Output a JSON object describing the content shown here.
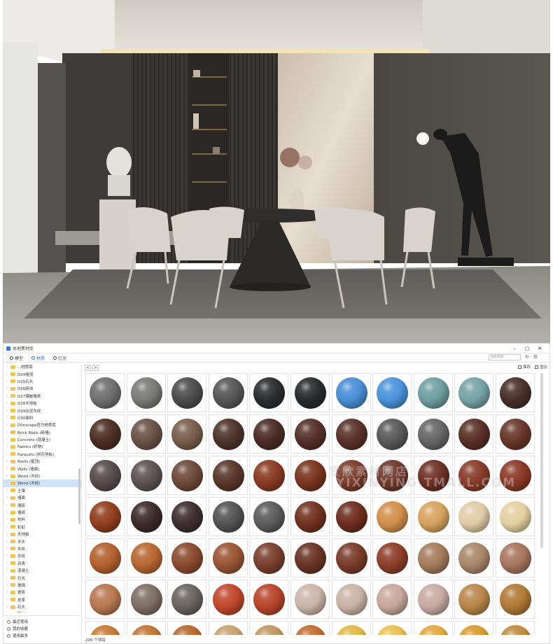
{
  "window": {
    "title": "本地素材库",
    "minimize": "–",
    "maximize": "▢",
    "close": "✕"
  },
  "tabs": [
    {
      "label": "模型",
      "active": false
    },
    {
      "label": "材质",
      "active": true
    },
    {
      "label": "灯光",
      "active": false
    }
  ],
  "sidebar": {
    "items": [
      {
        "label": "...材质库",
        "expanded": false,
        "selected": false
      },
      {
        "label": "D24墙顶",
        "selected": false
      },
      {
        "label": "D25石头",
        "selected": false
      },
      {
        "label": "D26砖块",
        "selected": false
      },
      {
        "label": "D27镶嵌墙纸",
        "selected": false
      },
      {
        "label": "D28木地板",
        "selected": false
      },
      {
        "label": "D29水泥木纹",
        "selected": false
      },
      {
        "label": "D30面料",
        "selected": false
      },
      {
        "label": "D0nscape官方材质库",
        "selected": false
      },
      {
        "label": "Brick Walls (砖墙)",
        "selected": false
      },
      {
        "label": "Concrete (混凝土)",
        "selected": false
      },
      {
        "label": "Fabrics (织物)",
        "selected": false
      },
      {
        "label": "Parquets (拼花地板)",
        "selected": false
      },
      {
        "label": "Roofs (屋顶)",
        "selected": false
      },
      {
        "label": "Walls (墙面)",
        "selected": false
      },
      {
        "label": "Wood (木纹)",
        "selected": false
      },
      {
        "label": "Wood (木纹)",
        "selected": true
      },
      {
        "label": "土壤",
        "selected": false
      },
      {
        "label": "墙面",
        "selected": false
      },
      {
        "label": "墙砖",
        "selected": false
      },
      {
        "label": "墙纸",
        "selected": false
      },
      {
        "label": "布料",
        "selected": false
      },
      {
        "label": "彩虹",
        "selected": false
      },
      {
        "label": "木地板",
        "selected": false
      },
      {
        "label": "木头",
        "selected": false
      },
      {
        "label": "木纹",
        "selected": false
      },
      {
        "label": "水纹",
        "selected": false
      },
      {
        "label": "沥青",
        "selected": false
      },
      {
        "label": "混凝土",
        "selected": false
      },
      {
        "label": "灯光",
        "selected": false
      },
      {
        "label": "玻璃",
        "selected": false
      },
      {
        "label": "瓷砖",
        "selected": false
      },
      {
        "label": "皮革",
        "selected": false
      },
      {
        "label": "石头",
        "selected": false
      },
      {
        "label": "草地",
        "selected": false
      },
      {
        "label": "织物",
        "selected": false
      },
      {
        "label": "塑料",
        "selected": false
      },
      {
        "label": "车漆",
        "selected": false
      },
      {
        "label": "车灯",
        "selected": false
      }
    ],
    "bottom": [
      {
        "label": "最近使用",
        "icon": "clock-icon"
      },
      {
        "label": "我的收藏",
        "icon": "star-icon"
      },
      {
        "label": "使用最多",
        "icon": "chart-icon"
      }
    ]
  },
  "toolbar": {
    "back": "<",
    "forward": ">",
    "search_placeholder": "搜索材质...",
    "refresh": "↻",
    "menu": "☰",
    "save_label": "保存",
    "display_label": "显示"
  },
  "status": {
    "count_text": "200 个项目"
  },
  "watermark": {
    "line1": "宜欣素材网店",
    "line2": "YIXINYING.TMALL.COM"
  },
  "materials": {
    "rows": [
      [
        "#6f6f6f",
        "#7a7a78",
        "#4c4d4c",
        "#565756",
        "#2c2d2f",
        "#2a2b2d",
        "#4a8fd6",
        "#4a93da",
        "#6e9ea2",
        "#76a2a6",
        "#4a3028"
      ],
      [
        "#4d2f22",
        "#6a5346",
        "#7a5e4c",
        "#4e352b",
        "#4c2d25",
        "#55302a",
        "#5a3228",
        "#5a5a5a",
        "#666666",
        "#5a3026",
        "#6a382a"
      ],
      [
        "#584b4d",
        "#5d5355",
        "#6d4a3a",
        "#5a382b",
        "#8a3b22",
        "#7a351e",
        "#7c3b29",
        "#70382b",
        "#6e3125",
        "#8a3c2a",
        "#8c3a26"
      ],
      [
        "#933f1f",
        "#3d2b2b",
        "#3e2e2f",
        "#545454",
        "#5c5c5c",
        "#72321f",
        "#6e2e1f",
        "#d28f4a",
        "#d6a35e",
        "#e0cba6",
        "#e4cf9f"
      ],
      [
        "#b4612d",
        "#b86731",
        "#8a4b2e",
        "#9a5534",
        "#7a402e",
        "#6a3426",
        "#7a3c2a",
        "#8d3f29",
        "#a47c5c",
        "#a8886a",
        "#a8765e"
      ],
      [
        "#b87850",
        "#7e6e66",
        "#6a6460",
        "#c0482c",
        "#b8452a",
        "#cbb5a8",
        "#c9b3a6",
        "#c7a89a",
        "#c7aba2",
        "#b8864a",
        "#b07a36"
      ],
      [
        "#c77a36",
        "#c07534",
        "#b86a30",
        "#c8a070",
        "#c29660",
        "#c06e30",
        "#e0b848",
        "#e6c050",
        "#e2a63c",
        "#d89a30",
        "#c08a42"
      ]
    ]
  }
}
